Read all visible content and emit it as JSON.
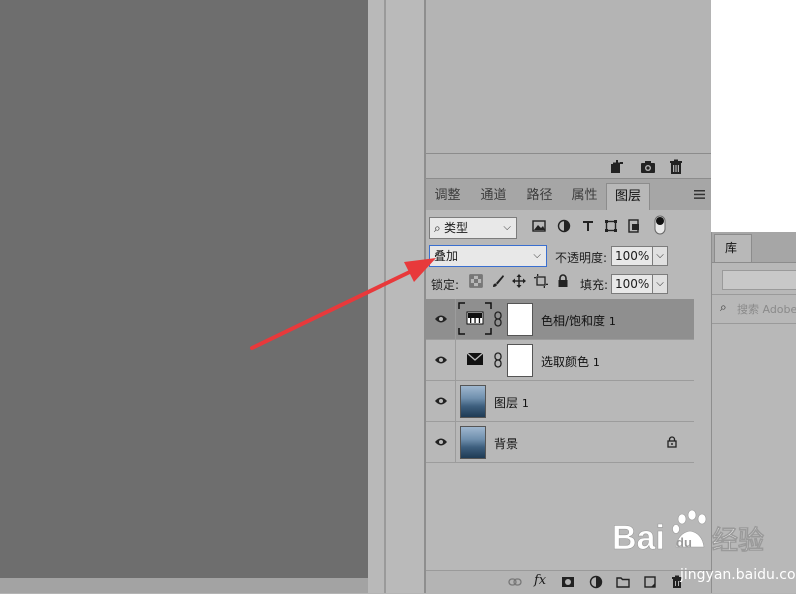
{
  "layers_panel": {
    "tabs": [
      {
        "label": "调整",
        "active": false
      },
      {
        "label": "通道",
        "active": false
      },
      {
        "label": "路径",
        "active": false
      },
      {
        "label": "属性",
        "active": false
      },
      {
        "label": "图层",
        "active": true
      }
    ],
    "filter": {
      "label": "类型",
      "icons": [
        "image-filter-icon",
        "adjustment-filter-icon",
        "type-filter-icon",
        "shape-filter-icon",
        "smart-object-filter-icon",
        "filter-toggle-icon"
      ]
    },
    "blend_mode": {
      "value": "叠加"
    },
    "opacity": {
      "label": "不透明度:",
      "value": "100%"
    },
    "lock": {
      "label": "锁定:"
    },
    "fill": {
      "label": "填充:",
      "value": "100%"
    },
    "layers": [
      {
        "name": "色相/饱和度",
        "index": "1",
        "type": "adjustment",
        "icon": "hue-saturation-icon",
        "selected": true,
        "visible": true,
        "locked": false
      },
      {
        "name": "选取颜色",
        "index": "1",
        "type": "adjustment",
        "icon": "selective-color-icon",
        "selected": false,
        "visible": true,
        "locked": false
      },
      {
        "name": "图层",
        "index": "1",
        "type": "pixel",
        "selected": false,
        "visible": true,
        "locked": false
      },
      {
        "name": "背景",
        "index": "",
        "type": "pixel",
        "selected": false,
        "visible": true,
        "locked": true
      }
    ],
    "footer_icons": [
      "link-layers-icon",
      "fx-icon",
      "add-mask-icon",
      "new-adjustment-icon",
      "new-group-icon",
      "new-layer-icon",
      "delete-layer-icon"
    ],
    "fx_label": "fx"
  },
  "history_panel": {
    "footer_icons": [
      "new-document-from-state-icon",
      "snapshot-camera-icon",
      "delete-state-icon"
    ]
  },
  "library_panel": {
    "tab_label": "库",
    "search_placeholder": "搜索 Adobe"
  },
  "watermark": {
    "text": "jingyan.baidu.com",
    "brand": "Bai 经验"
  },
  "colors": {
    "canvas": "#6e6e6e",
    "panel": "#b8b8b8",
    "selected_row": "#8f8f8f",
    "annotation_arrow": "#e8393b"
  }
}
